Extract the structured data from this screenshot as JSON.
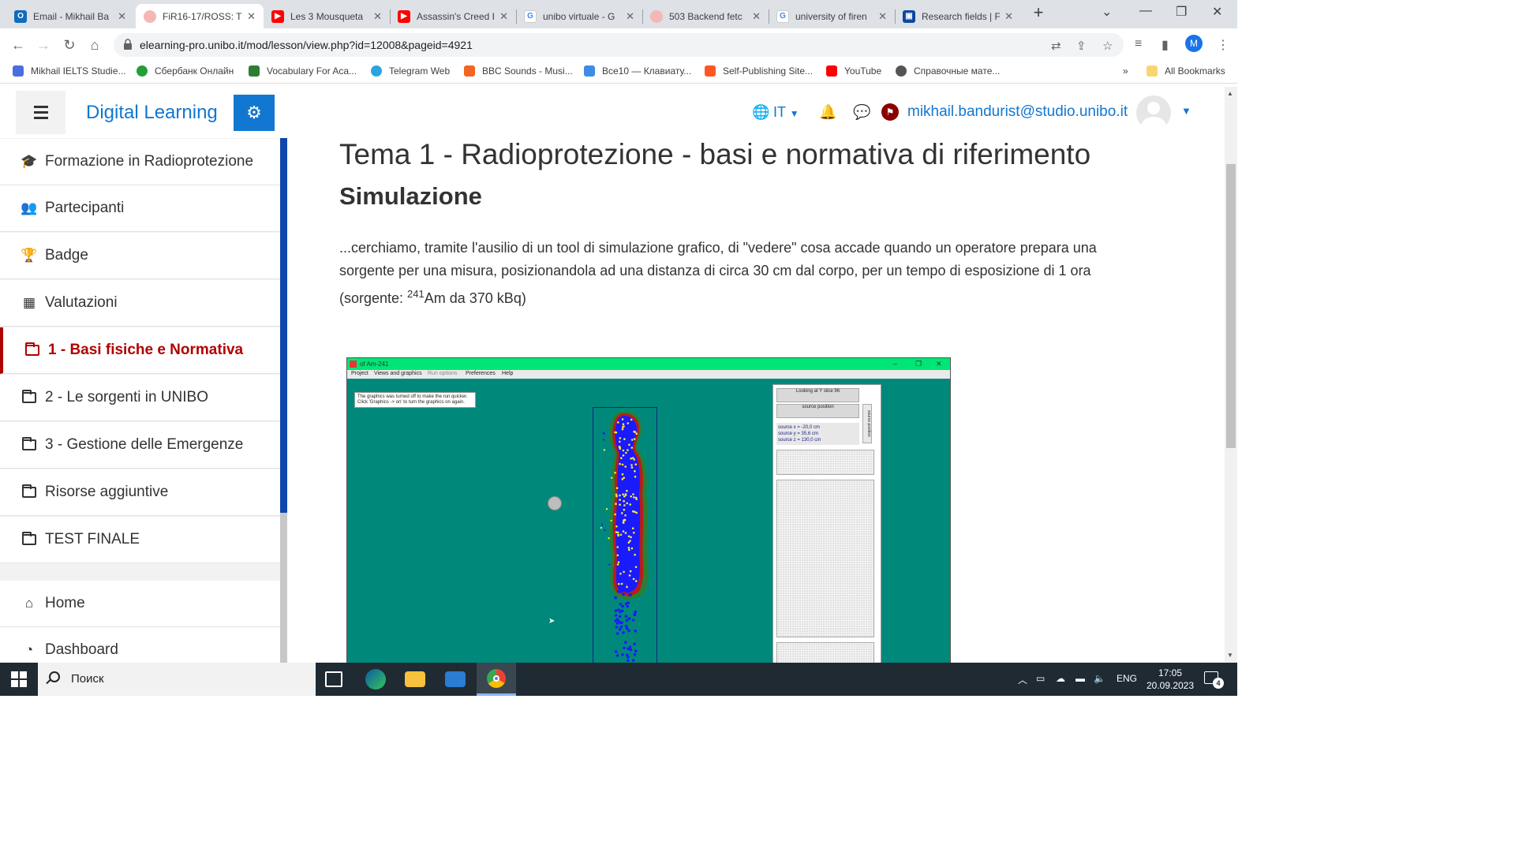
{
  "browser": {
    "tabs": [
      {
        "title": "Email - Mikhail Ba",
        "icon": "outlook-icon",
        "color": "#0f6cbd"
      },
      {
        "title": "FiR16-17/ROSS: T",
        "icon": "unibo-seal-icon",
        "color": "#f4b7b7"
      },
      {
        "title": "Les 3 Mousqueta",
        "icon": "youtube-icon",
        "color": "#ff0000"
      },
      {
        "title": "Assassin's Creed I",
        "icon": "youtube-icon",
        "color": "#ff0000"
      },
      {
        "title": "unibo virtuale - G",
        "icon": "google-icon",
        "color": "#4285f4"
      },
      {
        "title": "503 Backend fetc",
        "icon": "unibo-seal-icon",
        "color": "#f4b7b7"
      },
      {
        "title": "university of firen",
        "icon": "google-icon",
        "color": "#4285f4"
      },
      {
        "title": "Research fields | F",
        "icon": "unifi-icon",
        "color": "#0d47a1"
      }
    ],
    "url": "elearning-pro.unibo.it/mod/lesson/view.php?id=12008&pageid=4921",
    "profile_initial": "M",
    "bookmarks": [
      {
        "label": "Mikhail IELTS Studie...",
        "color": "#4a6ee0"
      },
      {
        "label": "Сбербанк Онлайн",
        "color": "#21a038"
      },
      {
        "label": "Vocabulary For Aca...",
        "color": "#2e7d32"
      },
      {
        "label": "Telegram Web",
        "color": "#2aa3e0"
      },
      {
        "label": "BBC Sounds - Musi...",
        "color": "#f26522"
      },
      {
        "label": "Все10 — Клавиату...",
        "color": "#3d8ce6"
      },
      {
        "label": "Self-Publishing Site...",
        "color": "#ff5722"
      },
      {
        "label": "YouTube",
        "color": "#ff0000"
      },
      {
        "label": "Справочные мате...",
        "color": "#555555"
      }
    ],
    "bookmarks_overflow": "»",
    "all_bookmarks": "All Bookmarks"
  },
  "header": {
    "brand": "Digital Learning",
    "language": "IT",
    "user_email": "mikhail.bandurist@studio.unibo.it"
  },
  "sidebar": {
    "items": [
      {
        "label": "Formazione in Radioprotezione",
        "icon": "graduation-cap-icon"
      },
      {
        "label": "Partecipanti",
        "icon": "users-icon"
      },
      {
        "label": "Badge",
        "icon": "trophy-icon"
      },
      {
        "label": "Valutazioni",
        "icon": "table-icon"
      },
      {
        "label": "1 - Basi fisiche e Normativa",
        "icon": "folder-icon",
        "active": true
      },
      {
        "label": "2 - Le sorgenti in UNIBO",
        "icon": "folder-icon"
      },
      {
        "label": "3 - Gestione delle Emergenze",
        "icon": "folder-icon"
      },
      {
        "label": "Risorse aggiuntive",
        "icon": "folder-icon"
      },
      {
        "label": "TEST FINALE",
        "icon": "folder-icon"
      }
    ],
    "nav": [
      {
        "label": "Home",
        "icon": "home-icon"
      },
      {
        "label": "Dashboard",
        "icon": "dashboard-icon"
      }
    ]
  },
  "lesson": {
    "title": "Tema 1 - Radioprotezione - basi e normativa di riferimento",
    "subtitle": "Simulazione",
    "text_1": "...cerchiamo, tramite l'ausilio di un tool di simulazione grafico, di \"vedere\" cosa accade quando un operatore prepara una sorgente per una misura, posizionandola ad una distanza di circa 30 cm dal corpo, per un tempo di esposizione di 1 ora (sorgente: ",
    "isotope_mass": "241",
    "text_2": "Am da 370 kBq)"
  },
  "simulation": {
    "window_title": "of Am-241",
    "menu": [
      "Project",
      "Views and graphics",
      "Run options",
      "Preferences",
      "Help"
    ],
    "note": "The graphics was turned off to make the run quicker. Click 'Graphics -> on' to turn the graphics on again.",
    "panel_slice": "Looking at Y slice 96",
    "panel_source": "source position",
    "panel_vertical": "source position",
    "source_x": "source x = -20,0 cm",
    "source_y": "source y = 35,6 cm",
    "source_z": "source z = 130,0 cm"
  },
  "taskbar": {
    "search_placeholder": "Поиск",
    "language": "ENG",
    "time": "17:05",
    "date": "20.09.2023",
    "notifications": "4"
  }
}
